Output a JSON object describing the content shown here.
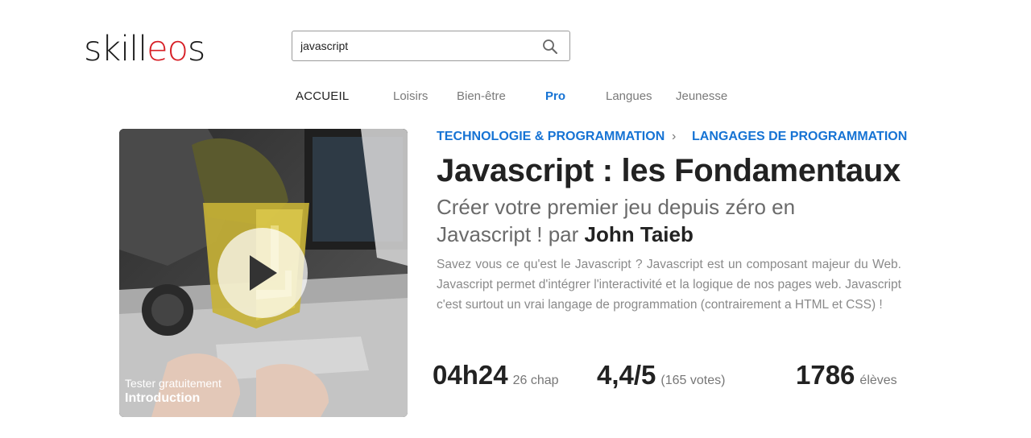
{
  "logo": {
    "part1": "skill",
    "part2": "eo",
    "part3": "s"
  },
  "search": {
    "value": "javascript",
    "icon": "search-icon"
  },
  "nav": {
    "home": "ACCUEIL",
    "items": [
      "Loisirs",
      "Bien-être",
      "Pro",
      "Langues",
      "Jeunesse"
    ],
    "active": "Pro",
    "active_color": "#1673d4"
  },
  "course": {
    "breadcrumb": [
      "TECHNOLOGIE & PROGRAMMATION",
      "LANGAGES DE PROGRAMMATION"
    ],
    "title": "Javascript : les Fondamentaux",
    "subtitle": "Créer votre premier jeu depuis zéro en Javascript ! par",
    "author": "John Taieb",
    "description": "Savez vous ce qu'est le Javascript ? Javascript est un composant majeur du Web. Javascript permet d'intégrer l'interactivité et la logique de nos pages web. Javascript c'est surtout un vrai langage de programmation (contrairement a HTML et CSS) !",
    "video": {
      "try_label": "Tester gratuitement",
      "chapter": "Introduction",
      "icon": "play-icon"
    },
    "stats": {
      "duration": "04h24",
      "chapters": "26 chap",
      "rating": "4,4/5",
      "votes": "(165 votes)",
      "students": "1786",
      "students_label": "élèves"
    }
  },
  "colors": {
    "accent": "#1673d4",
    "brand_red": "#d71f26",
    "js_yellow": "#f0db4f"
  }
}
